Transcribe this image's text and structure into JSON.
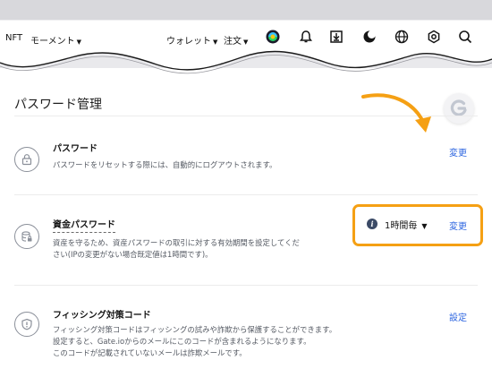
{
  "nav": {
    "nft": "NFT",
    "moment": "モーメント",
    "wallet": "ウォレット",
    "orders": "注文"
  },
  "page": {
    "title": "パスワード管理"
  },
  "rows": [
    {
      "title": "パスワード",
      "desc": [
        "パスワードをリセットする際には、自動的にログアウトされます。"
      ],
      "action": "変更"
    },
    {
      "title": "資金パスワード",
      "desc": [
        "資産を守るため、資産パスワードの取引に対する有効期間を設定してくだ",
        "さい(IPの変更がない場合既定値は1時間です)。"
      ],
      "interval": "1時間毎",
      "action": "変更"
    },
    {
      "title": "フィッシング対策コード",
      "desc": [
        "フィッシング対策コードはフィッシングの試みや詐欺から保護することができます。",
        "設定すると、Gate.ioからのメールにこのコードが含まれるようになります。",
        "このコードが記載されていないメールは詐欺メールです。"
      ],
      "action": "設定"
    }
  ],
  "colors": {
    "highlight": "#f5a014",
    "link": "#2e66e0"
  }
}
